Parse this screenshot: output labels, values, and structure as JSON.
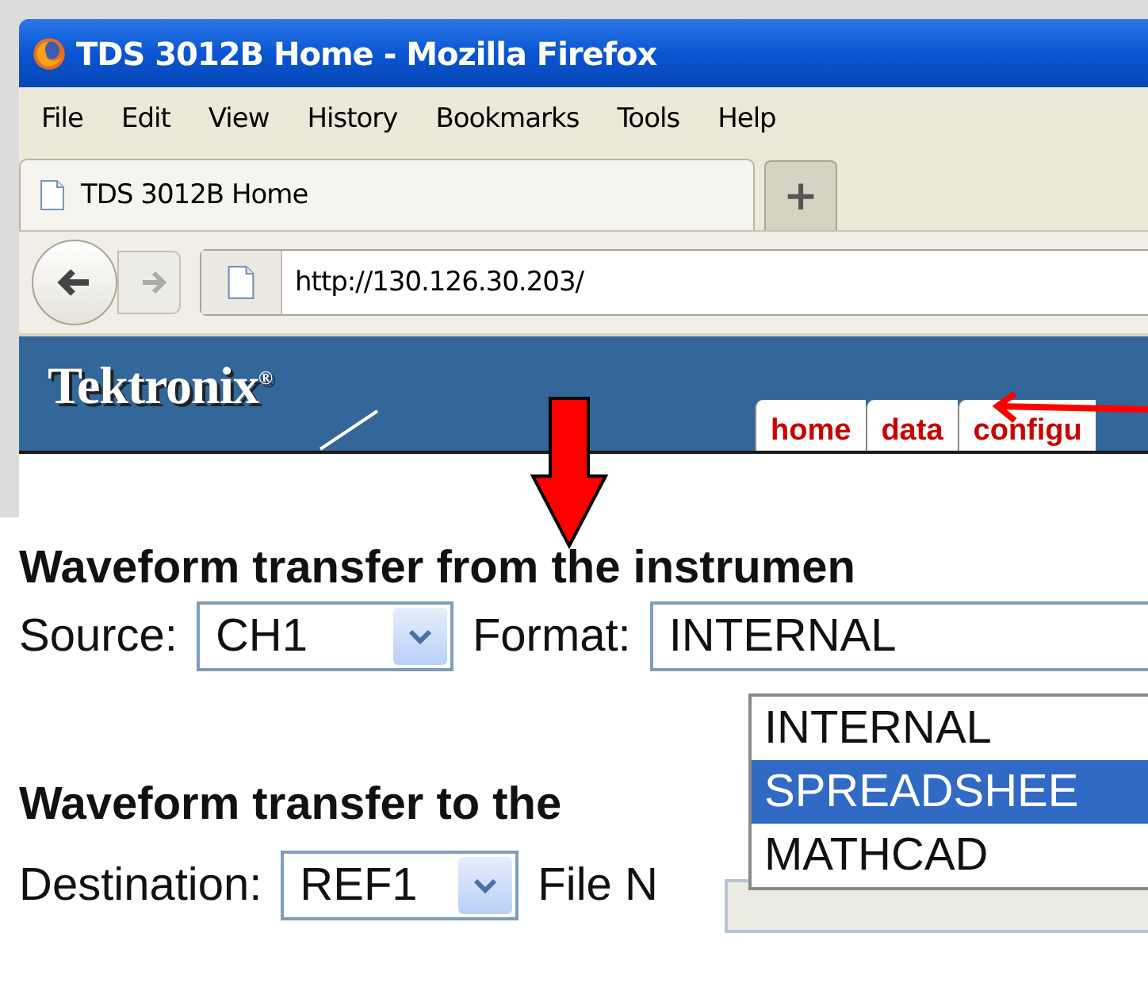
{
  "window": {
    "title": "TDS 3012B Home - Mozilla Firefox"
  },
  "menu": [
    "File",
    "Edit",
    "View",
    "History",
    "Bookmarks",
    "Tools",
    "Help"
  ],
  "tabs": [
    {
      "label": "TDS 3012B Home",
      "selected": true
    }
  ],
  "new_tab_button": "+",
  "address_bar": {
    "value": "http://130.126.30.203/"
  },
  "site": {
    "logo": "Tektronix$^{®}$",
    "nav_tabs": [
      "home",
      "data",
      "configu"
    ]
  },
  "form": {
    "section_1": {
      "heading": "Waveform transfer from the instrumen",
      "source_label": "Source:",
      "source_value": "CH1",
      "format_label": "Format:",
      "format_value": "INTERNAL",
      "format_options": [
        {
          "label": "INTERNAL",
          "selected": false
        },
        {
          "label": "SPREADSHEE",
          "selected": true
        },
        {
          "label": "MATHCAD",
          "selected": false
        }
      ]
    },
    "section_2": {
      "heading": "Waveform transfer to the",
      "destination_label": "Destination:",
      "destination_value": "REF1",
      "file_name_label": "File N"
    }
  }
}
